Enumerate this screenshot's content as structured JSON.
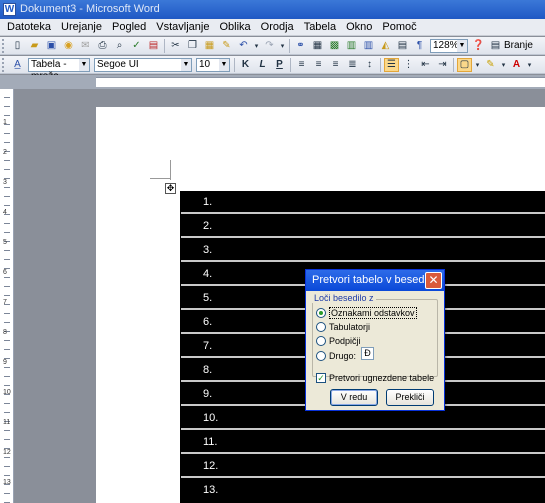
{
  "window": {
    "title": "Dokument3 - Microsoft Word"
  },
  "menu": {
    "items": [
      "Datoteka",
      "Urejanje",
      "Pogled",
      "Vstavljanje",
      "Oblika",
      "Orodja",
      "Tabela",
      "Okno",
      "Pomoč"
    ]
  },
  "toolbar1": {
    "zoom": "128%",
    "read_label": "Branje"
  },
  "toolbar2": {
    "style": "Tabela - mreža",
    "font": "Segoe UI",
    "size": "10"
  },
  "table": {
    "rows": [
      "1.",
      "2.",
      "3.",
      "4.",
      "5.",
      "6.",
      "7.",
      "8.",
      "9.",
      "10.",
      "11.",
      "12.",
      "13."
    ]
  },
  "dialog": {
    "title": "Pretvori tabelo v besedilo",
    "group_label": "Loči besedilo z",
    "options": [
      "Oznakami odstavkov",
      "Tabulatorji",
      "Podpičji",
      "Drugo:"
    ],
    "other_value": "Đ",
    "checkbox_label": "Pretvori ugnezdene tabele",
    "ok_label": "V redu",
    "cancel_label": "Prekliči"
  },
  "ruler": {
    "numbers": [
      "1",
      "2",
      "3",
      "4",
      "5",
      "6",
      "7",
      "8",
      "9",
      "10",
      "11",
      "12",
      "13"
    ]
  }
}
